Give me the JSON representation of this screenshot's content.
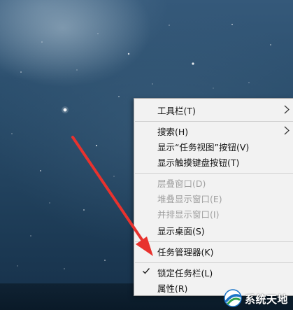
{
  "menu": {
    "items": [
      {
        "label": "工具栏(T)",
        "has_submenu": true,
        "enabled": true
      },
      {
        "label": "搜索(H)",
        "has_submenu": true,
        "enabled": true
      },
      {
        "label": "显示“任务视图”按钮(V)",
        "has_submenu": false,
        "enabled": true
      },
      {
        "label": "显示触摸键盘按钮(T)",
        "has_submenu": false,
        "enabled": true
      },
      {
        "label": "层叠窗口(D)",
        "has_submenu": false,
        "enabled": false
      },
      {
        "label": "堆叠显示窗口(E)",
        "has_submenu": false,
        "enabled": false
      },
      {
        "label": "并排显示窗口(I)",
        "has_submenu": false,
        "enabled": false
      },
      {
        "label": "显示桌面(S)",
        "has_submenu": false,
        "enabled": true
      },
      {
        "label": "任务管理器(K)",
        "has_submenu": false,
        "enabled": true,
        "highlighted_by_arrow": true
      },
      {
        "label": "锁定任务栏(L)",
        "has_submenu": false,
        "enabled": true,
        "checked": true
      },
      {
        "label": "属性(R)",
        "has_submenu": false,
        "enabled": true
      }
    ]
  },
  "watermark": {
    "text": "系统天地"
  },
  "colors": {
    "menu_background": "#f2f2f2",
    "disabled_text": "#a0a0a0",
    "arrow_annotation": "#e8322e",
    "taskbar": "#0b1c2b"
  },
  "icons": {
    "submenu": "chevron-right-icon",
    "check": "checkmark-icon",
    "annotation": "red-arrow-icon",
    "watermark_logo": "globe-logo-icon"
  }
}
